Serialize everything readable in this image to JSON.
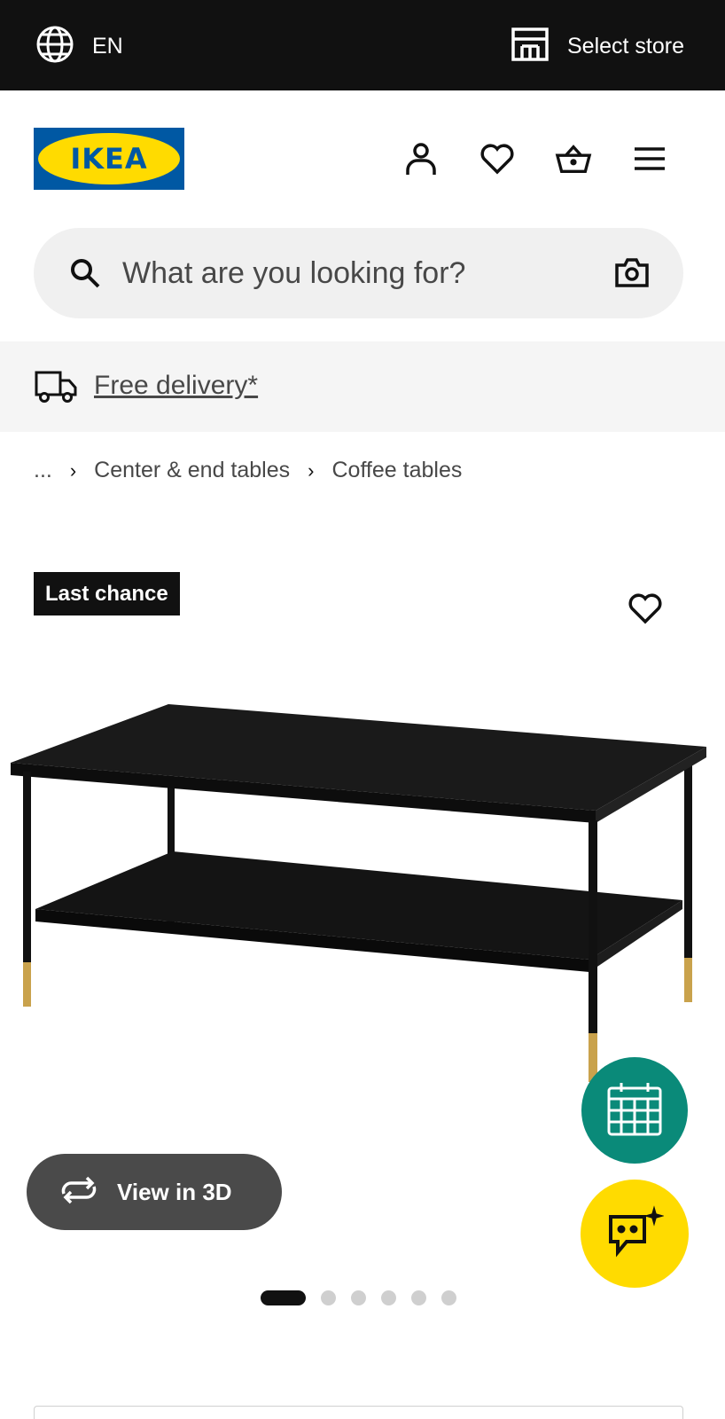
{
  "topbar": {
    "language": "EN",
    "store_label": "Select store"
  },
  "header": {
    "logo_text": "IKEA"
  },
  "search": {
    "placeholder": "What are you looking for?"
  },
  "delivery": {
    "label": "Free delivery*"
  },
  "breadcrumb": {
    "items": [
      "...",
      "Center & end tables",
      "Coffee tables"
    ]
  },
  "product": {
    "badge": "Last chance",
    "view3d_label": "View in 3D"
  },
  "carousel": {
    "total": 6,
    "active_index": 0
  },
  "colors": {
    "brand_blue": "#0058a3",
    "brand_yellow": "#ffdb00",
    "calendar_teal": "#0a8a79",
    "topbar": "#111111"
  }
}
